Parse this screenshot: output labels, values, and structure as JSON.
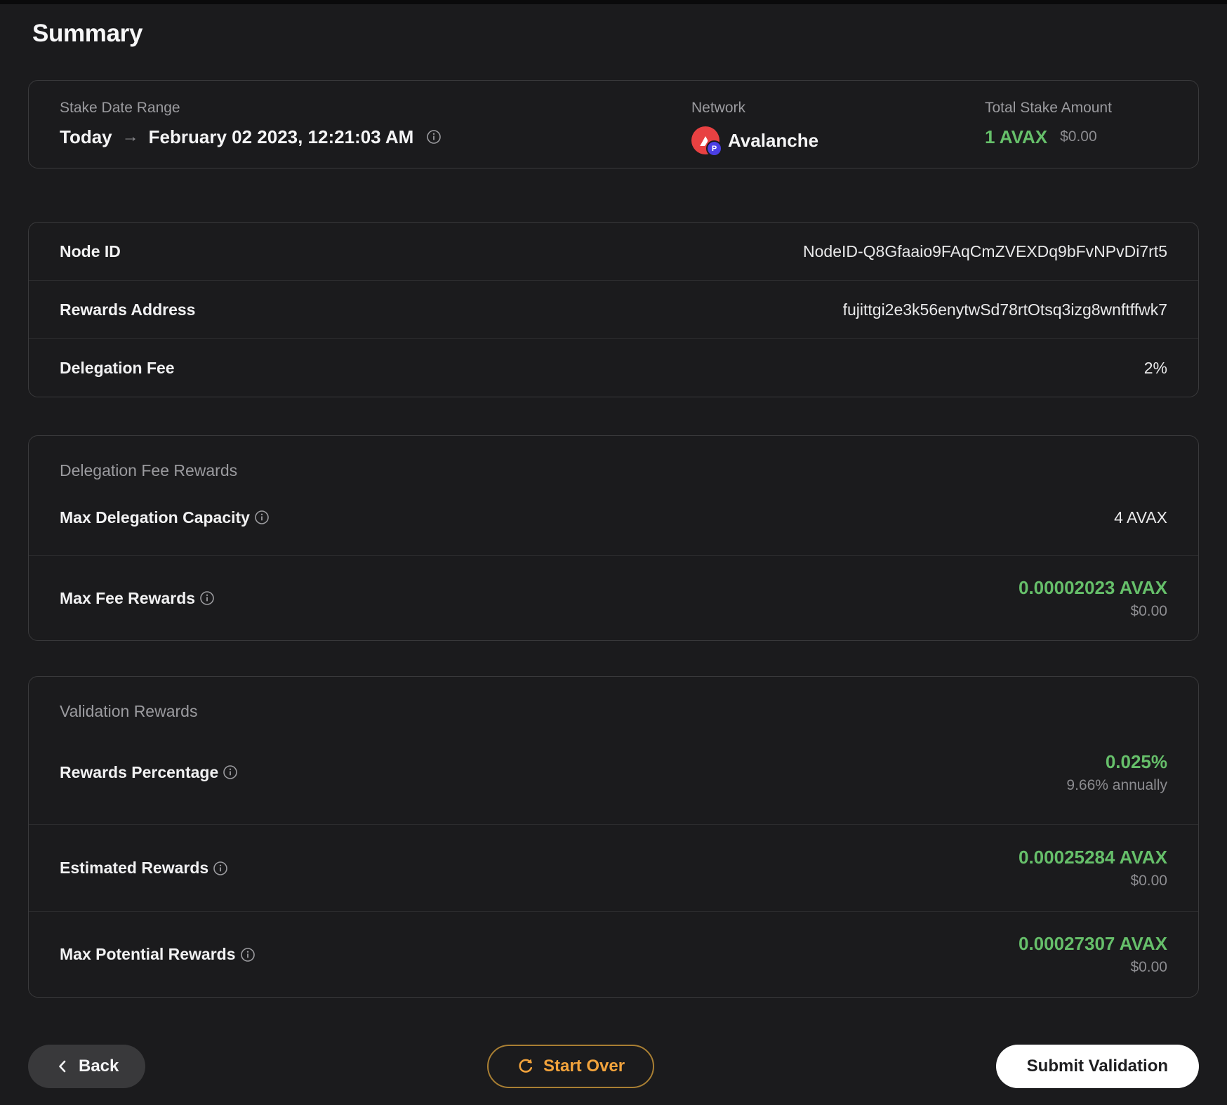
{
  "page": {
    "title": "Summary"
  },
  "colors": {
    "background": "#1b1b1d",
    "card_border": "#3a3a3c",
    "divider": "#2c2c2e",
    "label_gray": "#9b9b9f",
    "sub_gray": "#8c8c90",
    "accent_green": "#66bf6a",
    "accent_orange": "#f2a33c",
    "avalanche_red": "#e84142",
    "badge_purple": "#4b3fe4"
  },
  "icons": {
    "arrow_right": "→",
    "info": "i-in-circle",
    "back_chevron": "left-chevron",
    "start_over": "clockwise-refresh-arc",
    "avalanche": "red-circle-white-mountain",
    "p_chain_badge": "P"
  },
  "overview": {
    "stake_date_range": {
      "label": "Stake Date Range",
      "from": "Today",
      "arrow_glyph": "→",
      "to": "February 02 2023, 12:21:03 AM"
    },
    "network": {
      "label": "Network",
      "value": "Avalanche",
      "badge_letter": "P"
    },
    "total_stake": {
      "label": "Total Stake Amount",
      "amount": "1 AVAX",
      "usd": "$0.00"
    }
  },
  "details": {
    "rows": [
      {
        "label": "Node ID",
        "value": "NodeID-Q8Gfaaio9FAqCmZVEXDq9bFvNPvDi7rt5"
      },
      {
        "label": "Rewards Address",
        "value": "fujittgi2e3k56enytwSd78rtOtsq3izg8wnftffwk7"
      },
      {
        "label": "Delegation Fee",
        "value": "2%"
      }
    ]
  },
  "delegation_fee_rewards": {
    "section_label": "Delegation Fee Rewards",
    "max_delegation_capacity": {
      "label": "Max Delegation Capacity",
      "value": "4 AVAX"
    },
    "max_fee_rewards": {
      "label": "Max Fee Rewards",
      "value": "0.00002023 AVAX",
      "usd": "$0.00"
    }
  },
  "validation_rewards": {
    "section_label": "Validation Rewards",
    "rewards_percentage": {
      "label": "Rewards Percentage",
      "value": "0.025%",
      "sub": "9.66% annually"
    },
    "estimated_rewards": {
      "label": "Estimated Rewards",
      "value": "0.00025284 AVAX",
      "sub": "$0.00"
    },
    "max_potential_rewards": {
      "label": "Max Potential Rewards",
      "value": "0.00027307 AVAX",
      "sub": "$0.00"
    }
  },
  "footer": {
    "back_label": "Back",
    "start_over_label": "Start Over",
    "submit_label": "Submit Validation"
  }
}
